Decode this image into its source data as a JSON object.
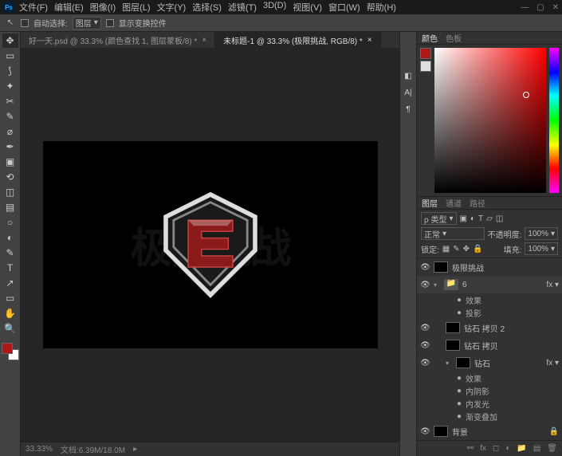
{
  "app": {
    "logo": "Ps"
  },
  "menu": [
    "文件(F)",
    "编辑(E)",
    "图像(I)",
    "图层(L)",
    "文字(Y)",
    "选择(S)",
    "滤镜(T)",
    "3D(D)",
    "视图(V)",
    "窗口(W)",
    "帮助(H)"
  ],
  "optbar": {
    "auto_select": "自动选择:",
    "select_mode": "图层",
    "show_transform": "显示变换控件"
  },
  "tabs": [
    {
      "label": "好一天.psd @ 33.3% (颜色查找 1, 图层蒙板/8) *",
      "active": false
    },
    {
      "label": "未标题-1 @ 33.3% (极限挑战, RGB/8) *",
      "active": true
    }
  ],
  "canvas": {
    "bgtext": "极限挑战"
  },
  "statusbar": {
    "zoom": "33.33%",
    "info": "文档:6.39M/18.0M"
  },
  "colorpanel": {
    "tab1": "颜色",
    "tab2": "色板",
    "fg": "#b01818",
    "bg": "#e0e0e0"
  },
  "layerspanel": {
    "tabs": [
      "图层",
      "通道",
      "路径"
    ],
    "kind": "ρ 类型",
    "blend": "正常",
    "opacity_label": "不透明度:",
    "opacity": "100%",
    "lock": "锁定:",
    "fill_label": "填充:",
    "fill": "100%",
    "layers": [
      {
        "type": "layer",
        "name": "极限挑战",
        "eye": true
      },
      {
        "type": "group",
        "name": "6",
        "eye": true,
        "open": true
      },
      {
        "type": "effects",
        "name": "效果"
      },
      {
        "type": "effect",
        "name": "投影"
      },
      {
        "type": "layer",
        "name": "钻石 拷贝 2",
        "eye": true,
        "indent": 1
      },
      {
        "type": "layer",
        "name": "钻石 拷贝",
        "eye": true,
        "indent": 1
      },
      {
        "type": "layer",
        "name": "钻石",
        "eye": true,
        "fx": true,
        "indent": 1,
        "open": true
      },
      {
        "type": "effects",
        "name": "效果"
      },
      {
        "type": "effect",
        "name": "内阴影"
      },
      {
        "type": "effect",
        "name": "内发光"
      },
      {
        "type": "effect",
        "name": "渐变叠加"
      },
      {
        "type": "layer",
        "name": "背景",
        "eye": true,
        "locked": true
      }
    ]
  },
  "tools": [
    "↖",
    "▭",
    "◌",
    "✂",
    "✎",
    "✓",
    "✉",
    "✒",
    "⌫",
    "▬",
    "◔",
    "✎",
    "T",
    "↗",
    "✋",
    "🔍"
  ]
}
